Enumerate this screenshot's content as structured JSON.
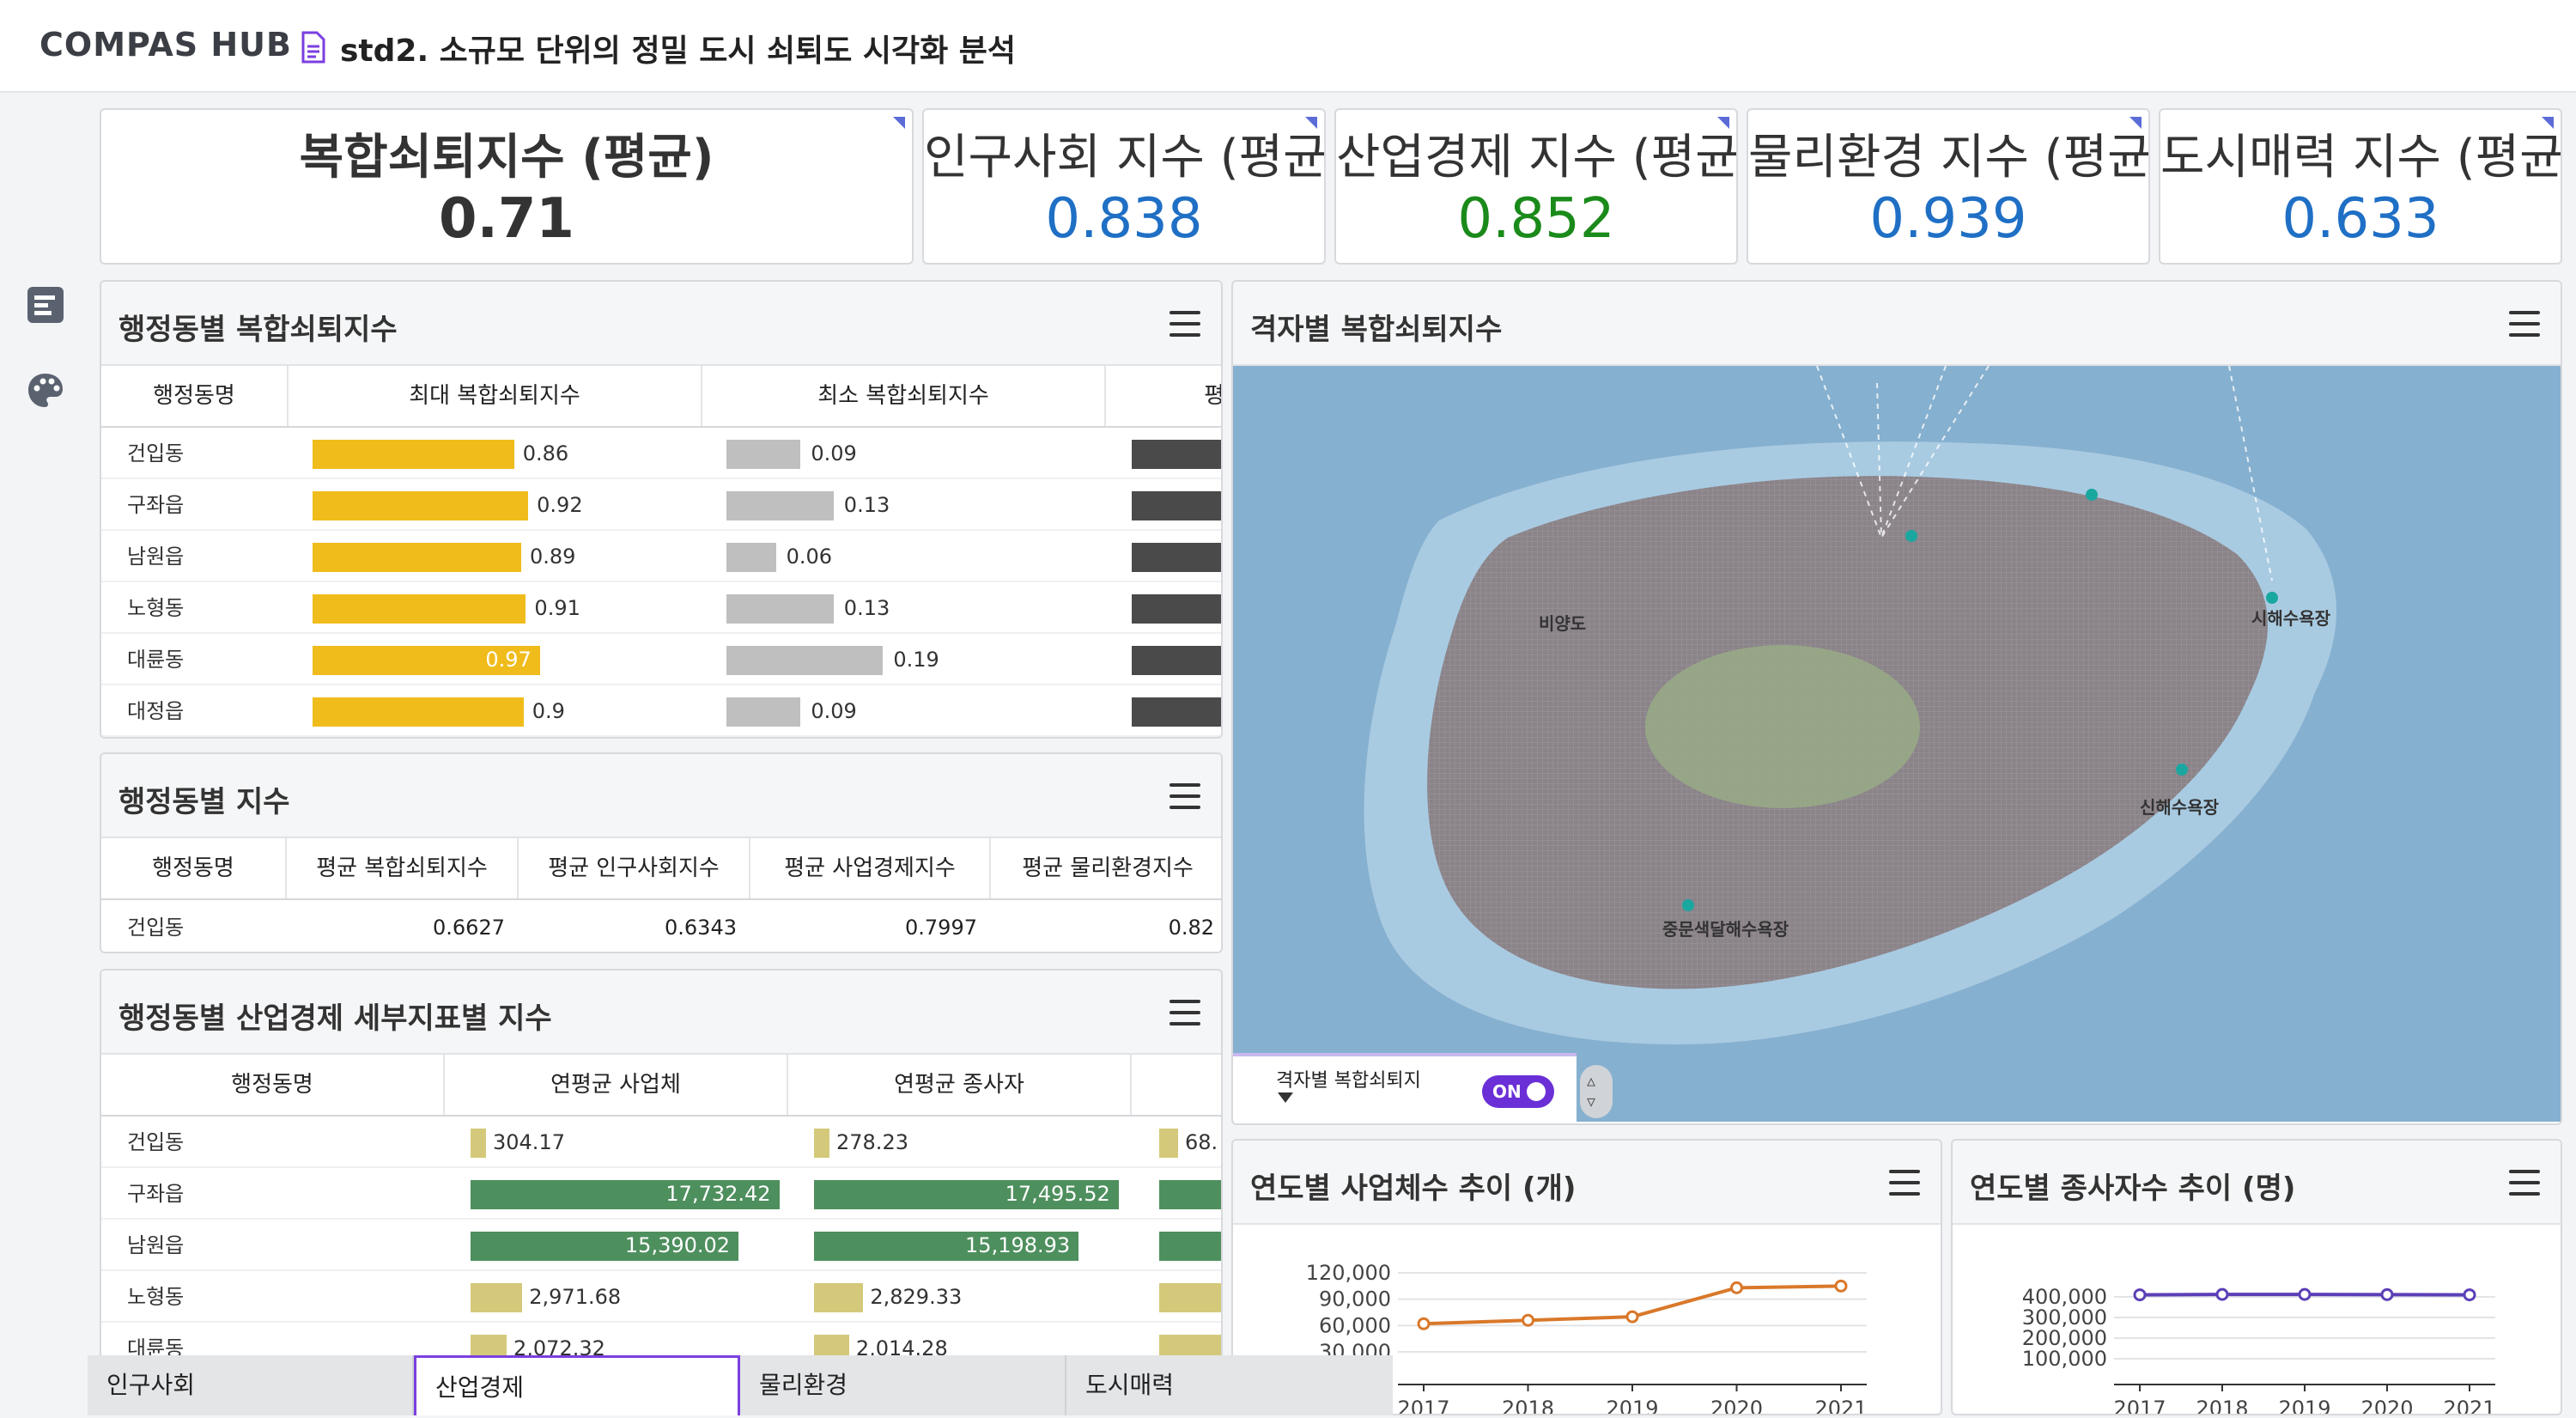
{
  "app": {
    "logo": "COMPAS HUB",
    "doc_title": "std2. 소규모 단위의 정밀 도시 쇠퇴도 시각화 분석"
  },
  "kpis": [
    {
      "title": "복합쇠퇴지수 (평균)",
      "value": "0.71",
      "color": "#333333"
    },
    {
      "title": "인구사회 지수 (평균)",
      "value": "0.838",
      "color": "#1f6fc5"
    },
    {
      "title": "산업경제 지수 (평균)",
      "value": "0.852",
      "color": "#1a8a1a"
    },
    {
      "title": "물리환경 지수 (평균)",
      "value": "0.939",
      "color": "#1f6fc5"
    },
    {
      "title": "도시매력 지수 (평균)",
      "value": "0.633",
      "color": "#1f6fc5"
    }
  ],
  "panel1": {
    "title": "행정동별 복합쇠퇴지수",
    "columns": [
      "행정동명",
      "최대 복합쇠퇴지수",
      "최소 복합쇠퇴지수",
      "평"
    ],
    "rows": [
      {
        "name": "건입동",
        "max": 0.86,
        "max_label": "0.86",
        "min": 0.09,
        "min_label": "0.09"
      },
      {
        "name": "구좌읍",
        "max": 0.92,
        "max_label": "0.92",
        "min": 0.13,
        "min_label": "0.13"
      },
      {
        "name": "남원읍",
        "max": 0.89,
        "max_label": "0.89",
        "min": 0.06,
        "min_label": "0.06"
      },
      {
        "name": "노형동",
        "max": 0.91,
        "max_label": "0.91",
        "min": 0.13,
        "min_label": "0.13"
      },
      {
        "name": "대륜동",
        "max": 0.97,
        "max_label": "0.97",
        "min": 0.19,
        "min_label": "0.19"
      },
      {
        "name": "대정읍",
        "max": 0.9,
        "max_label": "0.9",
        "min": 0.09,
        "min_label": "0.09"
      }
    ]
  },
  "panel2": {
    "title": "행정동별 지수",
    "columns": [
      "행정동명",
      "평균 복합쇠퇴지수",
      "평균 인구사회지수",
      "평균 사업경제지수",
      "평균 물리환경지수"
    ],
    "rows": [
      {
        "name": "건입동",
        "c1": "0.6627",
        "c2": "0.6343",
        "c3": "0.7997",
        "c4": "0.82"
      }
    ]
  },
  "panel3": {
    "title": "행정동별 산업경제 세부지표별 지수",
    "columns": [
      "행정동명",
      "연평균 사업체",
      "연평균 종사자"
    ],
    "rows": [
      {
        "name": "건입동",
        "biz": 304.17,
        "biz_label": "304.17",
        "emp": 278.23,
        "emp_label": "278.23",
        "third_label": "68."
      },
      {
        "name": "구좌읍",
        "biz": 17732.42,
        "biz_label": "17,732.42",
        "emp": 17495.52,
        "emp_label": "17,495.52",
        "third_label": ""
      },
      {
        "name": "남원읍",
        "biz": 15390.02,
        "biz_label": "15,390.02",
        "emp": 15198.93,
        "emp_label": "15,198.93",
        "third_label": ""
      },
      {
        "name": "노형동",
        "biz": 2971.68,
        "biz_label": "2,971.68",
        "emp": 2829.33,
        "emp_label": "2,829.33",
        "third_label": ""
      },
      {
        "name": "대륜동",
        "biz": 2072.32,
        "biz_label": "2,072.32",
        "emp": 2014.28,
        "emp_label": "2,014.28",
        "third_label": ""
      }
    ]
  },
  "map": {
    "title": "격자별 복합쇠퇴지수",
    "places": [
      "비양도",
      "시해수욕장",
      "신해수욕장",
      "중문색달해수욕장"
    ],
    "layer_label": "격자별 복합쇠퇴지",
    "toggle_label": "ON"
  },
  "chart_biz": {
    "title": "연도별 사업체수 추이 (개)",
    "chart_data": {
      "type": "line",
      "x": [
        "2017",
        "2018",
        "2019",
        "2020",
        "2021"
      ],
      "series": [
        {
          "values": [
            62000,
            66000,
            70000,
            103000,
            105000
          ]
        }
      ],
      "ylim": [
        30000,
        120000
      ],
      "yticks": [
        "120,000",
        "90,000",
        "60,000",
        "30,000"
      ],
      "color": "#d9782a"
    }
  },
  "chart_emp": {
    "title": "연도별 종사자수 추이 (명)",
    "chart_data": {
      "type": "line",
      "x": [
        "2017",
        "2018",
        "2019",
        "2020",
        "2021"
      ],
      "series": [
        {
          "values": [
            410000,
            412000,
            412000,
            411000,
            410000
          ]
        }
      ],
      "ylim": [
        100000,
        400000
      ],
      "yticks": [
        "400,000",
        "300,000",
        "200,000",
        "100,000"
      ],
      "color": "#5b3fb6"
    }
  },
  "tabs": [
    "인구사회",
    "산업경제",
    "물리환경",
    "도시매력"
  ],
  "active_tab": 1,
  "colors": {
    "max_bar": "#f0bc1c",
    "min_bar": "#bfbfbf",
    "dark_bar": "#4a4a4a",
    "green_dark": "#4e8f5e",
    "green_light": "#d4c97a"
  }
}
